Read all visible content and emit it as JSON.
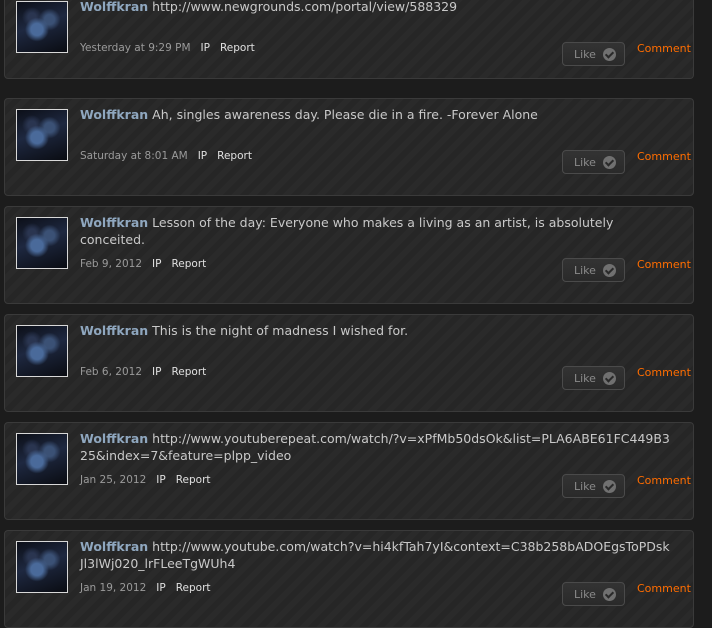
{
  "labels": {
    "ip": "IP",
    "report": "Report",
    "like": "Like",
    "comment": "Comment"
  },
  "posts": [
    {
      "author": "Wolffkran",
      "text": "http://www.newgrounds.com/portal/view/588329",
      "time": "Yesterday at 9:29 PM"
    },
    {
      "author": "Wolffkran",
      "text": "Ah, singles awareness day. Please die in a fire. -Forever Alone",
      "time": "Saturday at 8:01 AM"
    },
    {
      "author": "Wolffkran",
      "text": "Lesson of the day: Everyone who makes a living as an artist, is absolutely conceited.",
      "time": "Feb 9, 2012"
    },
    {
      "author": "Wolffkran",
      "text": "This is the night of madness I wished for.",
      "time": "Feb 6, 2012"
    },
    {
      "author": "Wolffkran",
      "text": "http://www.youtuberepeat.com/watch/?v=xPfMb50dsOk&list=PLA6ABE61FC449B325&index=7&feature=plpp_video",
      "time": "Jan 25, 2012"
    },
    {
      "author": "Wolffkran",
      "text": "http://www.youtube.com/watch?v=hi4kfTah7yI&context=C38b258bADOEgsToPDskJl3lWj020_lrFLeeTgWUh4",
      "time": "Jan 19, 2012"
    }
  ]
}
